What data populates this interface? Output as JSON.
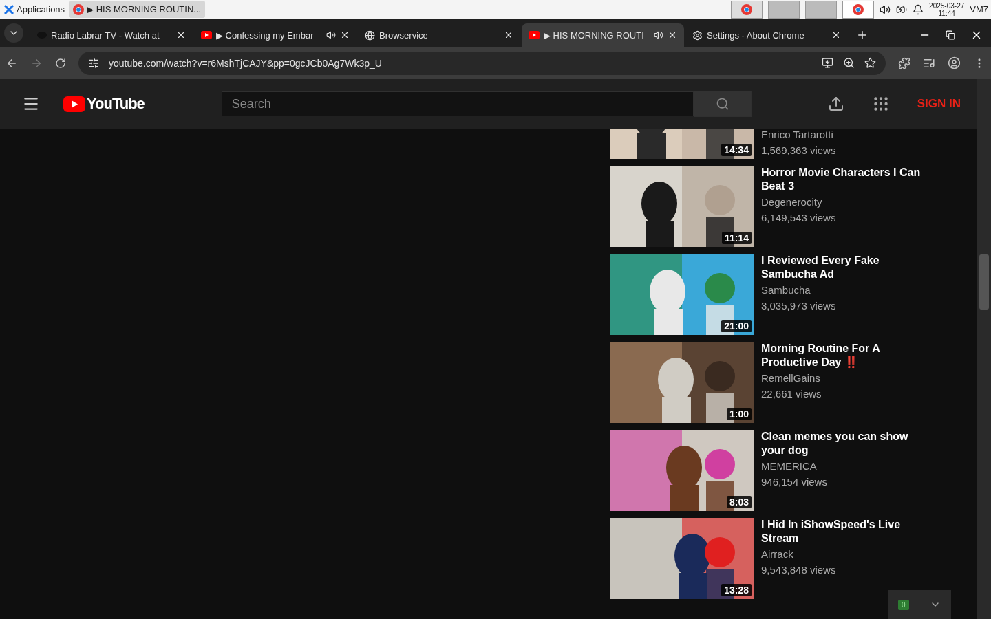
{
  "taskbar": {
    "menu_label": "Applications",
    "window_button": "▶ HIS MORNING ROUTIN...",
    "date": "2025-03-27",
    "time": "11:44",
    "user": "VM7"
  },
  "tabs": [
    {
      "title": "Radio Labrar TV - Watch at",
      "kind": "site",
      "audio": false,
      "selected": false
    },
    {
      "title": "▶ Confessing my Embar",
      "kind": "youtube",
      "audio": true,
      "selected": false
    },
    {
      "title": "Browservice",
      "kind": "globe",
      "audio": false,
      "selected": false
    },
    {
      "title": "▶ HIS MORNING ROUTI",
      "kind": "youtube",
      "audio": true,
      "selected": true
    },
    {
      "title": "Settings - About Chrome",
      "kind": "settings",
      "audio": false,
      "selected": false
    }
  ],
  "address": "youtube.com/watch?v=r6MshTjCAJY&pp=0gcJCb0Ag7Wk3p_U",
  "youtube": {
    "logo": "YouTube",
    "search_placeholder": "Search",
    "sign_in": "SIGN IN"
  },
  "videos": [
    {
      "channel": "Enrico Tartarotti",
      "views": "1,569,363 views",
      "duration": "14:34"
    },
    {
      "title": "Horror Movie Characters I Can Beat 3",
      "channel": "Degenerocity",
      "views": "6,149,543 views",
      "duration": "11:14"
    },
    {
      "title": "I Reviewed Every Fake Sambucha Ad",
      "channel": "Sambucha",
      "views": "3,035,973 views",
      "duration": "21:00"
    },
    {
      "title": "Morning Routine For A Productive Day ‼️",
      "channel": "RemellGains",
      "views": "22,661 views",
      "duration": "1:00"
    },
    {
      "title": "Clean memes you can show your dog",
      "channel": "MEMERICA",
      "views": "946,154 views",
      "duration": "8:03"
    },
    {
      "title": "I Hid In iShowSpeed's Live Stream",
      "channel": "Airrack",
      "views": "9,543,848 views",
      "duration": "13:28"
    }
  ],
  "badge": {
    "count": "0"
  }
}
